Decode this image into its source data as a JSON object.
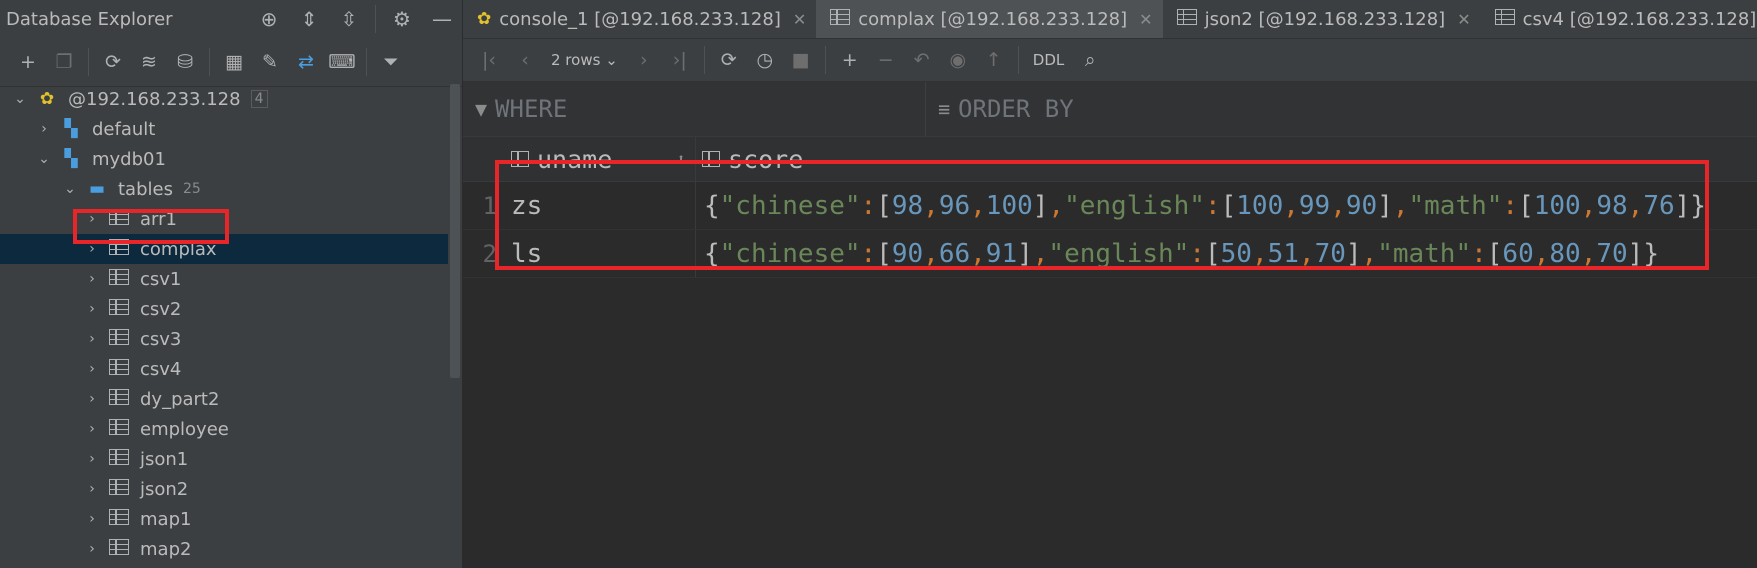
{
  "explorer": {
    "title": "Database Explorer",
    "connection": {
      "label": "@192.168.233.128",
      "count": "4"
    },
    "default_label": "default",
    "db_label": "mydb01",
    "tables": {
      "label": "tables",
      "count": "25"
    },
    "items": [
      "arr1",
      "complax",
      "csv1",
      "csv2",
      "csv3",
      "csv4",
      "dy_part2",
      "employee",
      "json1",
      "json2",
      "map1",
      "map2"
    ],
    "selected": "complax"
  },
  "tabs": [
    {
      "label": "console_1 [@192.168.233.128]",
      "icon": "console-icon",
      "active": false
    },
    {
      "label": "complax [@192.168.233.128]",
      "icon": "table-icon",
      "active": true
    },
    {
      "label": "json2 [@192.168.233.128]",
      "icon": "table-icon",
      "active": false
    },
    {
      "label": "csv4 [@192.168.233.128]",
      "icon": "table-icon",
      "active": false
    }
  ],
  "grid_toolbar": {
    "rows_label": "2 rows",
    "ddl_label": "DDL"
  },
  "filter": {
    "where_label": "WHERE",
    "order_label": "ORDER BY"
  },
  "columns": [
    "uname",
    "score"
  ],
  "rows": [
    {
      "num": "1",
      "uname": "zs",
      "chinese": [
        "98",
        "96",
        "100"
      ],
      "english": [
        "100",
        "99",
        "90"
      ],
      "math": [
        "100",
        "98",
        "76"
      ]
    },
    {
      "num": "2",
      "uname": "ls",
      "chinese": [
        "90",
        "66",
        "91"
      ],
      "english": [
        "50",
        "51",
        "70"
      ],
      "math": [
        "60",
        "80",
        "70"
      ]
    }
  ],
  "json_keys": {
    "chinese": "\"chinese\"",
    "english": "\"english\"",
    "math": "\"math\""
  },
  "colors": {
    "highlight": "#e8262a",
    "selection": "#0d293e",
    "json_string": "#6a8759",
    "json_number": "#6897bb"
  }
}
